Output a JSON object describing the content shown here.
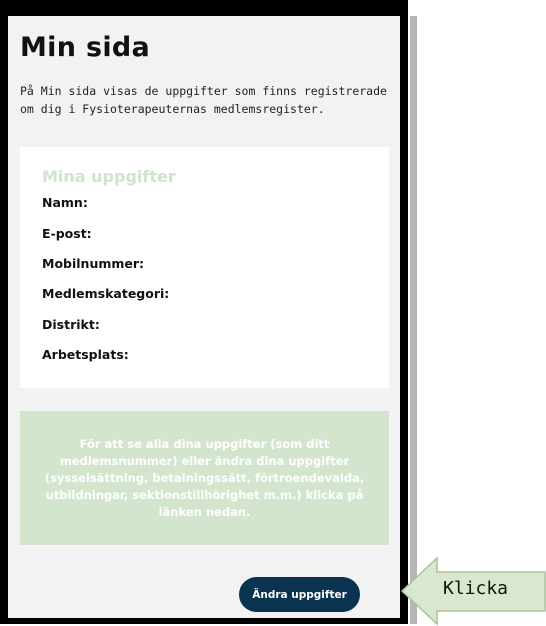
{
  "page": {
    "title": "Min sida",
    "intro": "På Min sida visas de uppgifter som finns registrerade om dig i Fysioterapeuternas medlemsregister."
  },
  "card": {
    "heading": "Mina uppgifter",
    "fields": [
      "Namn:",
      "E-post:",
      "Mobilnummer:",
      "Medlemskategori:",
      "Distrikt:",
      "Arbetsplats:"
    ]
  },
  "notice": {
    "text": "För att se alla dina uppgifter (som ditt medlemsnummer) eller ändra dina uppgifter (sysselsättning, betalningssätt, förtroendevalda, utbildningar, sektionstillhörighet m.m.) klicka på länken nedan."
  },
  "button": {
    "label": "Ändra uppgifter"
  },
  "callout": {
    "label": "Klicka"
  },
  "colors": {
    "button_bg": "#0a3350",
    "callout_fill": "#d9e7cf",
    "callout_stroke": "#a9c29b",
    "notice_bg": "#d3e5cd",
    "card_heading": "#cfe3cd"
  }
}
